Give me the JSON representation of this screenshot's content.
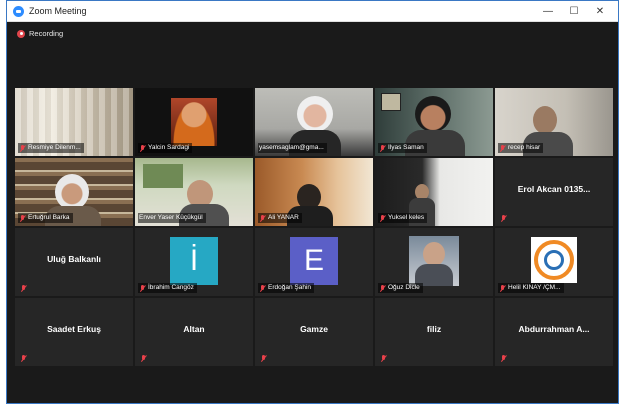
{
  "window": {
    "title": "Zoom Meeting",
    "controls": {
      "minimize": "—",
      "maximize": "☐",
      "close": "✕"
    }
  },
  "recording": {
    "label": "Recording"
  },
  "participants": [
    {
      "name": "Resmiye Dilenm..."
    },
    {
      "name": "Yalcin Sardagi"
    },
    {
      "name": "yasemsaglam@gma..."
    },
    {
      "name": "Ilyas Saman"
    },
    {
      "name": "recep hisar"
    },
    {
      "name": "Ertuğrul Barka"
    },
    {
      "name": "Enver Yaser Küçükgül"
    },
    {
      "name": "Ali YANAR"
    },
    {
      "name": "Yuksel keles"
    },
    {
      "name": "Erol Akcan 0135..."
    },
    {
      "name": "Uluğ Balkanlı"
    },
    {
      "name": "İbrahim Cangöz",
      "avatar": "İ"
    },
    {
      "name": "Erdoğan Şahin",
      "avatar": "E"
    },
    {
      "name": "Oğuz Dicle"
    },
    {
      "name": "Helil KINAY /ÇM..."
    },
    {
      "name": "Saadet Erkuş"
    },
    {
      "name": "Altan"
    },
    {
      "name": "Gamze"
    },
    {
      "name": "filiz"
    },
    {
      "name": "Abdurrahman A..."
    }
  ],
  "colors": {
    "active_speaker": "#c5e83d",
    "muted": "#e8414a",
    "avatar_i": "#26a8c4",
    "avatar_e": "#5b5fc7"
  }
}
